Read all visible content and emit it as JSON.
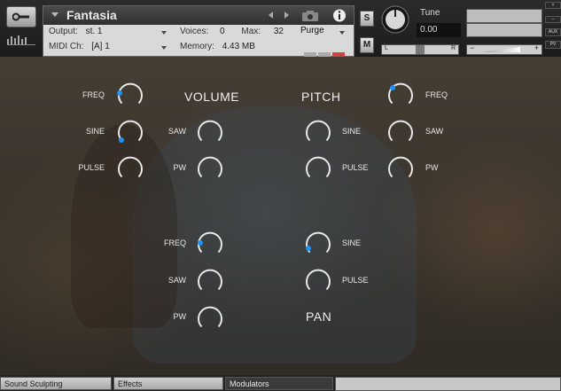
{
  "header": {
    "instrument_name": "Fantasia",
    "output_label": "Output:",
    "output_value": "st. 1",
    "voices_label": "Voices:",
    "voices_value": "0",
    "max_label": "Max:",
    "max_value": "32",
    "purge_label": "Purge",
    "midi_label": "MIDI Ch:",
    "midi_value": "[A]  1",
    "memory_label": "Memory:",
    "memory_value": "4.43 MB",
    "solo_label": "S",
    "mute_label": "M",
    "tune_label": "Tune",
    "tune_value": "0.00",
    "pan_left": "L",
    "pan_right": "R",
    "vol_minus": "−",
    "vol_plus": "+",
    "aux_label": "AUX",
    "pv_label": "PV",
    "logo_text": "ǁǁǁǁǁǁ"
  },
  "sections": {
    "volume": "VOLUME",
    "pitch": "PITCH",
    "pan": "PAN"
  },
  "knobs": {
    "freq": "FREQ",
    "sine": "SINE",
    "pulse": "PULSE",
    "saw": "SAW",
    "pw": "PW"
  },
  "tabs": [
    "Sound Sculpting",
    "Effects",
    "Modulators"
  ],
  "colors": {
    "accent": "#1e90ff",
    "knob_ring": "#e8e8e8"
  }
}
